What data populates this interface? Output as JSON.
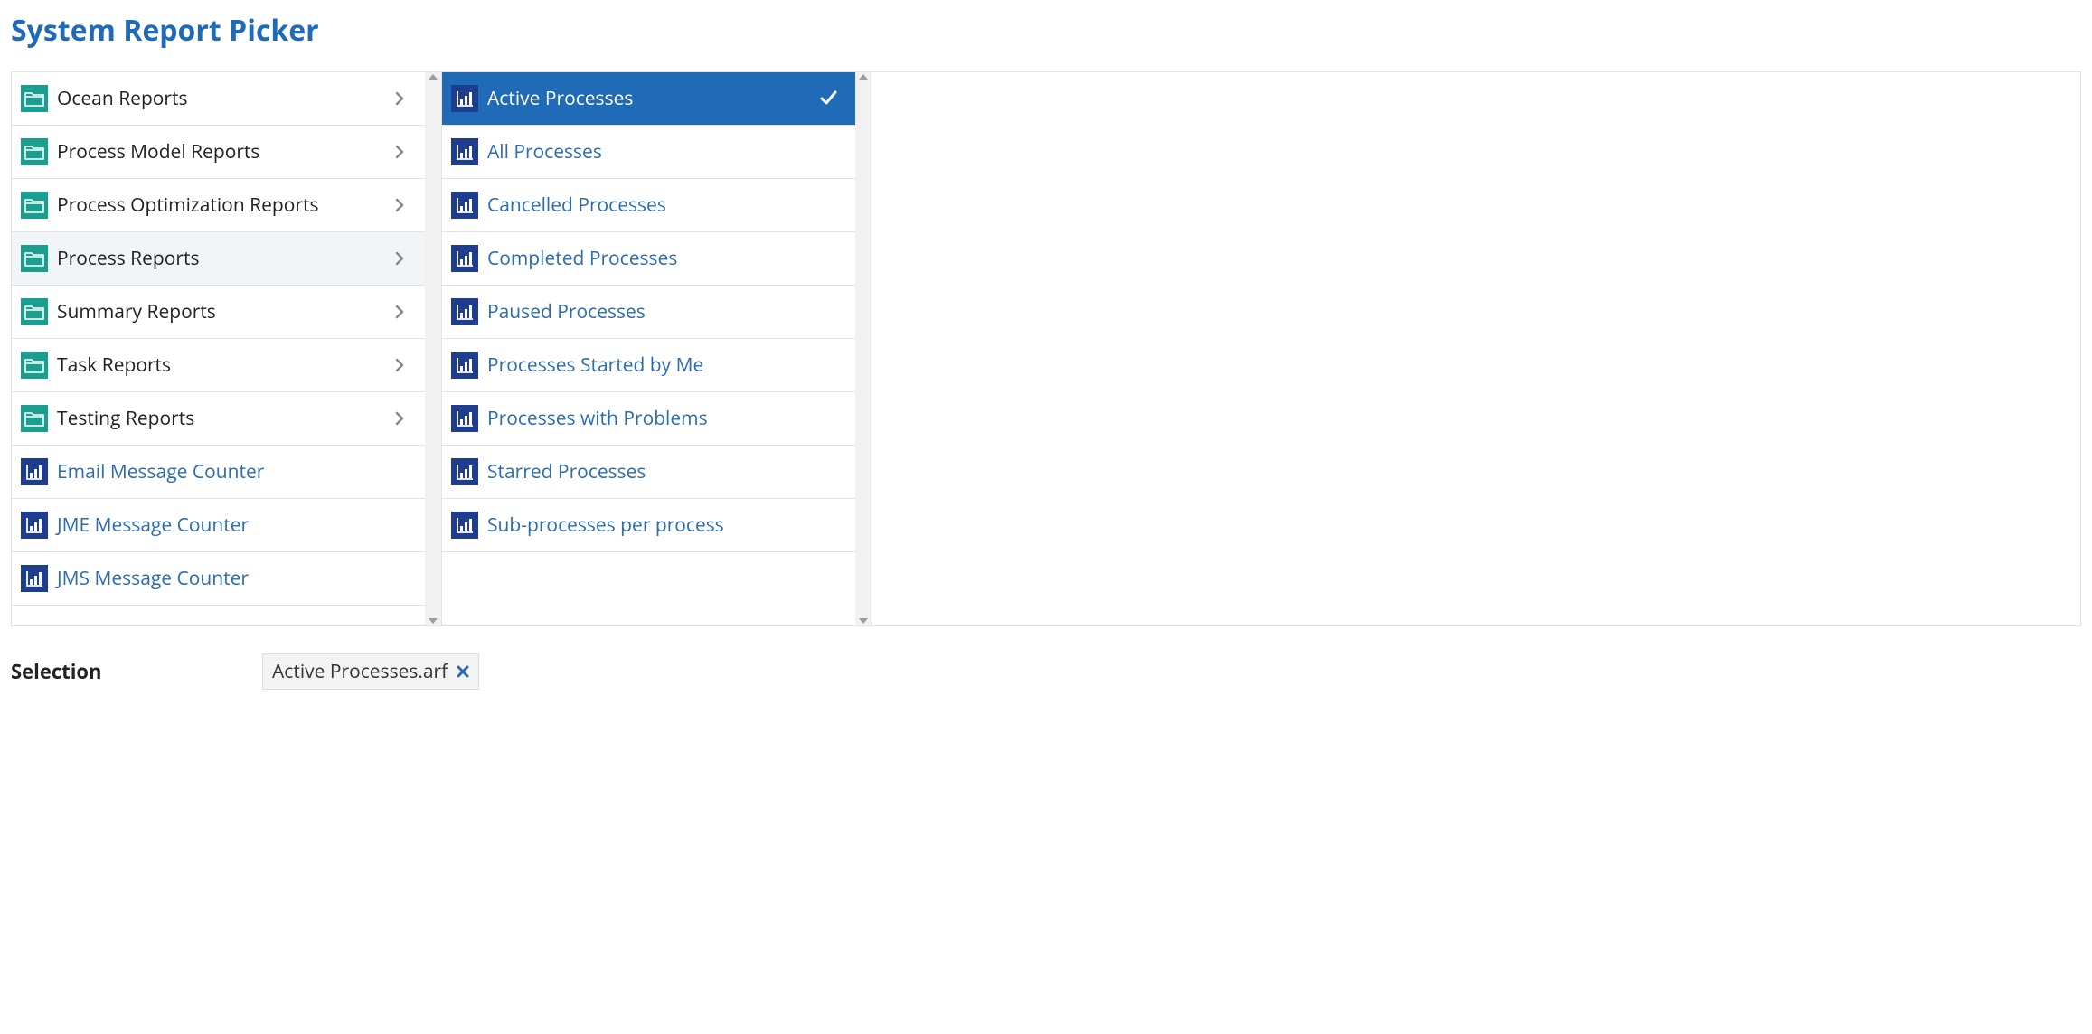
{
  "title": "System Report Picker",
  "column1": [
    {
      "type": "folder",
      "label": "Ocean Reports",
      "selected": false
    },
    {
      "type": "folder",
      "label": "Process Model Reports",
      "selected": false
    },
    {
      "type": "folder",
      "label": "Process Optimization Reports",
      "selected": false
    },
    {
      "type": "folder",
      "label": "Process Reports",
      "selected": true
    },
    {
      "type": "folder",
      "label": "Summary Reports",
      "selected": false
    },
    {
      "type": "folder",
      "label": "Task Reports",
      "selected": false
    },
    {
      "type": "folder",
      "label": "Testing Reports",
      "selected": false
    },
    {
      "type": "report",
      "label": "Email Message Counter",
      "selected": false
    },
    {
      "type": "report",
      "label": "JME Message Counter",
      "selected": false
    },
    {
      "type": "report",
      "label": "JMS Message Counter",
      "selected": false
    }
  ],
  "column2": [
    {
      "type": "report",
      "label": "Active Processes",
      "selected": true
    },
    {
      "type": "report",
      "label": "All Processes",
      "selected": false
    },
    {
      "type": "report",
      "label": "Cancelled Processes",
      "selected": false
    },
    {
      "type": "report",
      "label": "Completed Processes",
      "selected": false
    },
    {
      "type": "report",
      "label": "Paused Processes",
      "selected": false
    },
    {
      "type": "report",
      "label": "Processes Started by Me",
      "selected": false
    },
    {
      "type": "report",
      "label": "Processes with Problems",
      "selected": false
    },
    {
      "type": "report",
      "label": "Starred Processes",
      "selected": false
    },
    {
      "type": "report",
      "label": "Sub-processes per process",
      "selected": false
    }
  ],
  "selection": {
    "label": "Selection",
    "value": "Active Processes.arf"
  }
}
